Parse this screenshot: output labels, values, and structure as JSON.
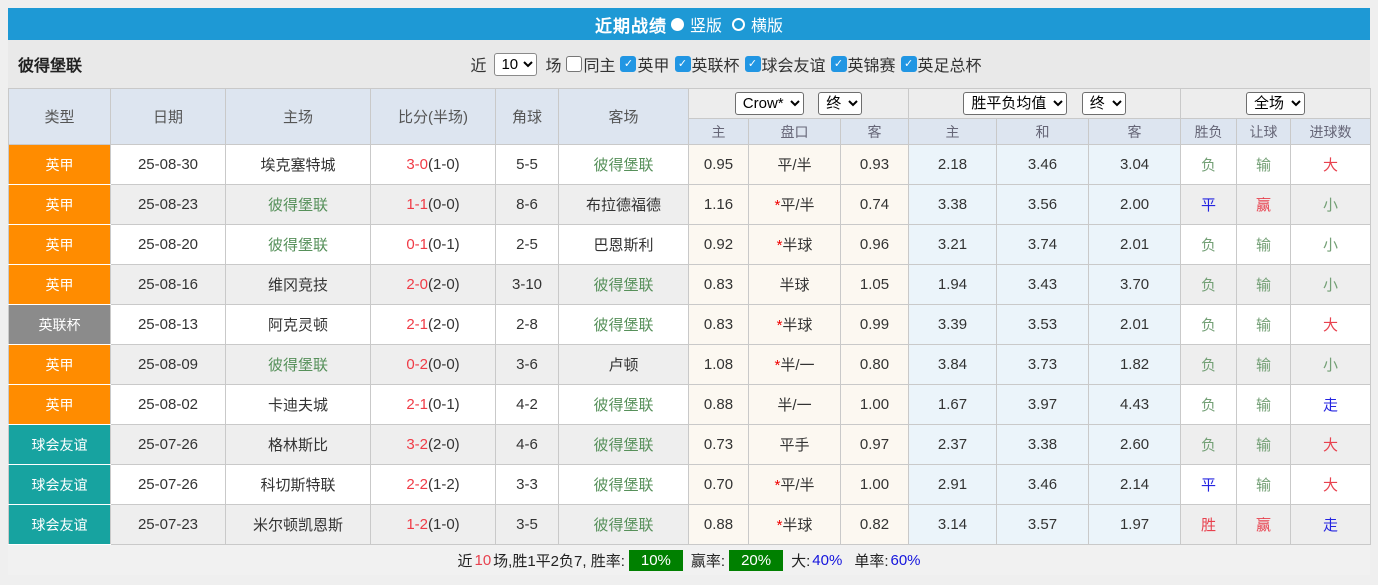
{
  "title": {
    "text": "近期战绩",
    "layout_options": [
      {
        "label": "竖版",
        "selected": true
      },
      {
        "label": "横版",
        "selected": false
      }
    ]
  },
  "filter": {
    "team": "彼得堡联",
    "recent_label": "近",
    "recent_value": "10",
    "matches_label": "场",
    "same_home": {
      "label": "同主",
      "checked": false
    },
    "competitions": [
      {
        "label": "英甲",
        "checked": true
      },
      {
        "label": "英联杯",
        "checked": true
      },
      {
        "label": "球会友谊",
        "checked": true
      },
      {
        "label": "英锦赛",
        "checked": true
      },
      {
        "label": "英足总杯",
        "checked": true
      }
    ]
  },
  "table": {
    "selects": {
      "odds_company": "Crow*",
      "odds_time1": "终",
      "avg_metric": "胜平负均值",
      "odds_time2": "终",
      "scope": "全场"
    },
    "col_headers": {
      "type": "类型",
      "date": "日期",
      "home": "主场",
      "score": "比分(半场)",
      "corner": "角球",
      "away": "客场"
    },
    "sub_headers": {
      "odds_home": "主",
      "handicap": "盘口",
      "odds_away": "客",
      "avg_home": "主",
      "avg_draw": "和",
      "avg_away": "客",
      "result": "胜负",
      "handicap_result": "让球",
      "goals": "进球数"
    },
    "type_colors": {
      "英甲": "#ff8c00",
      "英联杯": "#8b8b8b",
      "球会友谊": "#17a3a0"
    },
    "rows": [
      {
        "type": "英甲",
        "type_color": "#ff8c00",
        "date": "25-08-30",
        "home": "埃克塞特城",
        "home_team": false,
        "score": "3-0",
        "half": "(1-0)",
        "corner": "5-5",
        "away": "彼得堡联",
        "away_team": true,
        "odds_home": "0.95",
        "star": false,
        "handicap": "平/半",
        "odds_away": "0.93",
        "avg_home": "2.18",
        "avg_draw": "3.46",
        "avg_away": "3.04",
        "result": "负",
        "result_c": "green",
        "let": "输",
        "let_c": "green",
        "goal": "大",
        "goal_c": "red"
      },
      {
        "type": "英甲",
        "type_color": "#ff8c00",
        "date": "25-08-23",
        "home": "彼得堡联",
        "home_team": true,
        "score": "1-1",
        "half": "(0-0)",
        "corner": "8-6",
        "away": "布拉德福德",
        "away_team": false,
        "odds_home": "1.16",
        "star": true,
        "handicap": "平/半",
        "odds_away": "0.74",
        "avg_home": "3.38",
        "avg_draw": "3.56",
        "avg_away": "2.00",
        "result": "平",
        "result_c": "blue",
        "let": "赢",
        "let_c": "red",
        "goal": "小",
        "goal_c": "green"
      },
      {
        "type": "英甲",
        "type_color": "#ff8c00",
        "date": "25-08-20",
        "home": "彼得堡联",
        "home_team": true,
        "score": "0-1",
        "half": "(0-1)",
        "corner": "2-5",
        "away": "巴恩斯利",
        "away_team": false,
        "odds_home": "0.92",
        "star": true,
        "handicap": "半球",
        "odds_away": "0.96",
        "avg_home": "3.21",
        "avg_draw": "3.74",
        "avg_away": "2.01",
        "result": "负",
        "result_c": "green",
        "let": "输",
        "let_c": "green",
        "goal": "小",
        "goal_c": "green"
      },
      {
        "type": "英甲",
        "type_color": "#ff8c00",
        "date": "25-08-16",
        "home": "维冈竞技",
        "home_team": false,
        "score": "2-0",
        "half": "(2-0)",
        "corner": "3-10",
        "away": "彼得堡联",
        "away_team": true,
        "odds_home": "0.83",
        "star": false,
        "handicap": "半球",
        "odds_away": "1.05",
        "avg_home": "1.94",
        "avg_draw": "3.43",
        "avg_away": "3.70",
        "result": "负",
        "result_c": "green",
        "let": "输",
        "let_c": "green",
        "goal": "小",
        "goal_c": "green"
      },
      {
        "type": "英联杯",
        "type_color": "#8b8b8b",
        "date": "25-08-13",
        "home": "阿克灵顿",
        "home_team": false,
        "score": "2-1",
        "half": "(2-0)",
        "corner": "2-8",
        "away": "彼得堡联",
        "away_team": true,
        "odds_home": "0.83",
        "star": true,
        "handicap": "半球",
        "odds_away": "0.99",
        "avg_home": "3.39",
        "avg_draw": "3.53",
        "avg_away": "2.01",
        "result": "负",
        "result_c": "green",
        "let": "输",
        "let_c": "green",
        "goal": "大",
        "goal_c": "red"
      },
      {
        "type": "英甲",
        "type_color": "#ff8c00",
        "date": "25-08-09",
        "home": "彼得堡联",
        "home_team": true,
        "score": "0-2",
        "half": "(0-0)",
        "corner": "3-6",
        "away": "卢顿",
        "away_team": false,
        "odds_home": "1.08",
        "star": true,
        "handicap": "半/一",
        "odds_away": "0.80",
        "avg_home": "3.84",
        "avg_draw": "3.73",
        "avg_away": "1.82",
        "result": "负",
        "result_c": "green",
        "let": "输",
        "let_c": "green",
        "goal": "小",
        "goal_c": "green"
      },
      {
        "type": "英甲",
        "type_color": "#ff8c00",
        "date": "25-08-02",
        "home": "卡迪夫城",
        "home_team": false,
        "score": "2-1",
        "half": "(0-1)",
        "corner": "4-2",
        "away": "彼得堡联",
        "away_team": true,
        "odds_home": "0.88",
        "star": false,
        "handicap": "半/一",
        "odds_away": "1.00",
        "avg_home": "1.67",
        "avg_draw": "3.97",
        "avg_away": "4.43",
        "result": "负",
        "result_c": "green",
        "let": "输",
        "let_c": "green",
        "goal": "走",
        "goal_c": "blue"
      },
      {
        "type": "球会友谊",
        "type_color": "#17a3a0",
        "date": "25-07-26",
        "home": "格林斯比",
        "home_team": false,
        "score": "3-2",
        "half": "(2-0)",
        "corner": "4-6",
        "away": "彼得堡联",
        "away_team": true,
        "odds_home": "0.73",
        "star": false,
        "handicap": "平手",
        "odds_away": "0.97",
        "avg_home": "2.37",
        "avg_draw": "3.38",
        "avg_away": "2.60",
        "result": "负",
        "result_c": "green",
        "let": "输",
        "let_c": "green",
        "goal": "大",
        "goal_c": "red"
      },
      {
        "type": "球会友谊",
        "type_color": "#17a3a0",
        "date": "25-07-26",
        "home": "科切斯特联",
        "home_team": false,
        "score": "2-2",
        "half": "(1-2)",
        "corner": "3-3",
        "away": "彼得堡联",
        "away_team": true,
        "odds_home": "0.70",
        "star": true,
        "handicap": "平/半",
        "odds_away": "1.00",
        "avg_home": "2.91",
        "avg_draw": "3.46",
        "avg_away": "2.14",
        "result": "平",
        "result_c": "blue",
        "let": "输",
        "let_c": "green",
        "goal": "大",
        "goal_c": "red"
      },
      {
        "type": "球会友谊",
        "type_color": "#17a3a0",
        "date": "25-07-23",
        "home": "米尔顿凯恩斯",
        "home_team": false,
        "score": "1-2",
        "half": "(1-0)",
        "corner": "3-5",
        "away": "彼得堡联",
        "away_team": true,
        "odds_home": "0.88",
        "star": true,
        "handicap": "半球",
        "odds_away": "0.82",
        "avg_home": "3.14",
        "avg_draw": "3.57",
        "avg_away": "1.97",
        "result": "胜",
        "result_c": "red",
        "let": "赢",
        "let_c": "red",
        "goal": "走",
        "goal_c": "blue"
      }
    ]
  },
  "summary": {
    "part1": "近",
    "count": "10",
    "part2": "场,胜1平2负7, 胜率:",
    "win_rate": "10%",
    "label_profit": "赢率:",
    "profit_rate": "20%",
    "label_big": "大:",
    "big_rate": "40%",
    "label_single": "单率:",
    "single_rate": "60%"
  }
}
